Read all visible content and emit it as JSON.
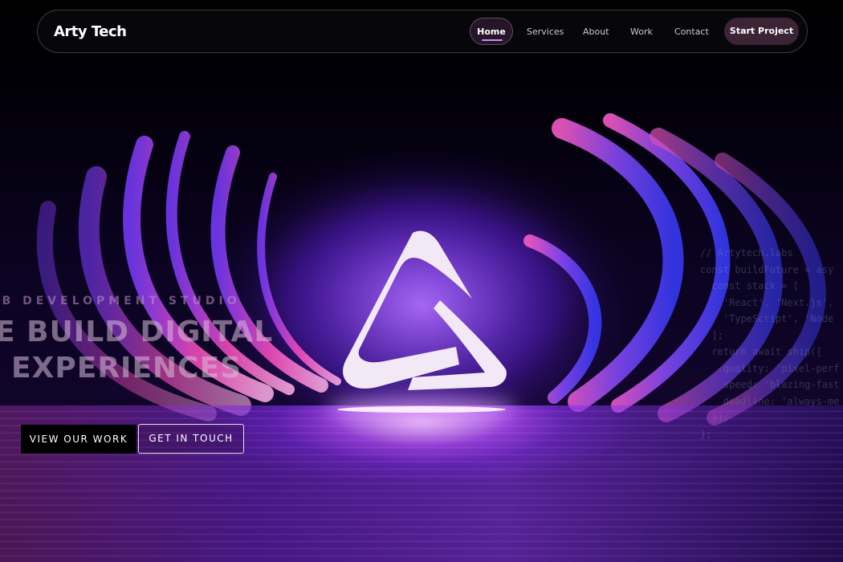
{
  "nav": {
    "brand": "Arty Tech",
    "items": [
      "Home",
      "Services",
      "About",
      "Work",
      "Contact"
    ],
    "active": "Home",
    "cta": "Start Project"
  },
  "hero": {
    "eyebrow": "EB DEVELOPMENT STUDIO",
    "headline_line1": "E BUILD DIGITAL",
    "headline_line2": "EXPERIENCES",
    "primary_button": "VIEW OUR WORK",
    "secondary_button": "GET IN TOUCH"
  },
  "code_snippet": [
    "// Artytech.labs",
    "const buildFuture = asy",
    "  const stack = [",
    "    'React', 'Next.js',",
    "    'TypeScript', 'Node",
    "  ];",
    "  return await ship({",
    "    quality: 'pixel-perf",
    "    speed: 'blazing-fast",
    "    deadline: 'always-me",
    "  });",
    "};"
  ],
  "colors": {
    "accent": "#c28bff",
    "cta_bg": "#3a2436",
    "background": "#000000"
  },
  "icons": {
    "logo": "triangle-logo-icon"
  }
}
